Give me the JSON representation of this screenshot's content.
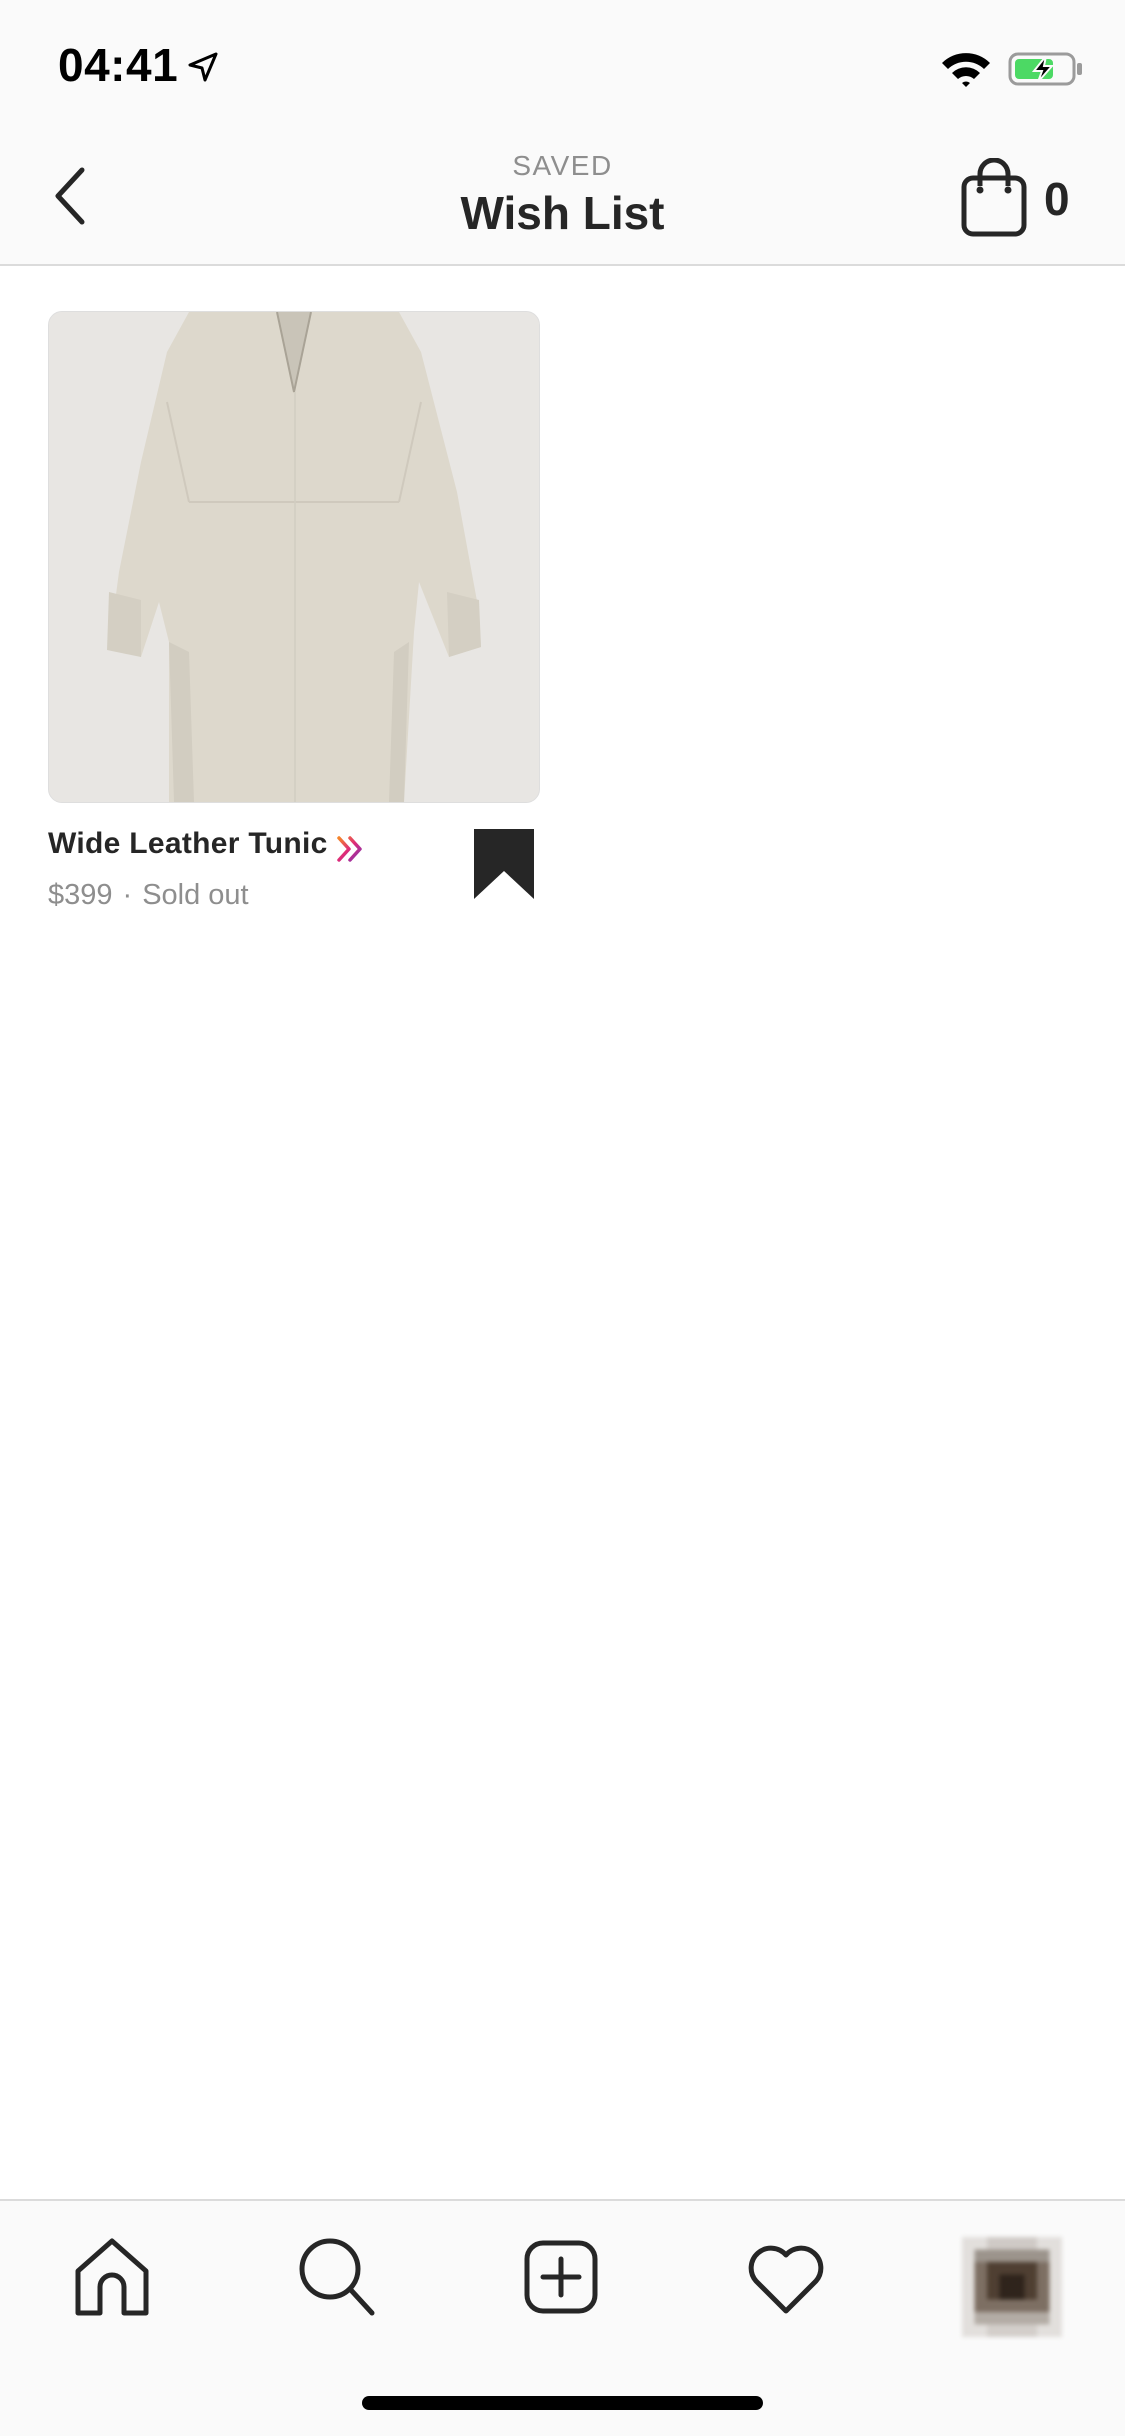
{
  "status_bar": {
    "time": "04:41",
    "icons": [
      "location-arrow-icon",
      "wifi-icon",
      "battery-charging-icon"
    ]
  },
  "header": {
    "kicker": "SAVED",
    "title": "Wish List",
    "back_icon": "chevron-left-icon",
    "bag_icon": "shopping-bag-icon",
    "bag_count": "0"
  },
  "products": [
    {
      "name": "Wide Leather Tunic",
      "price": "$399",
      "separator": "·",
      "availability": "Sold out",
      "image_icon": "tunic-photo",
      "badge_icon": "checkout-chevrons-icon",
      "bookmark_icon": "bookmark-filled-icon",
      "saved": true
    }
  ],
  "tab_bar": {
    "items": [
      "home-icon",
      "search-icon",
      "new-post-icon",
      "heart-icon",
      "profile-avatar"
    ]
  },
  "colors": {
    "text_primary": "#262626",
    "text_secondary": "#8e8e8e",
    "bar_background": "#fafafa",
    "divider": "#dbdbdb",
    "battery_green": "#4cd964",
    "checkout_gradient": [
      "#f58529",
      "#dd2a7b",
      "#8134af"
    ]
  }
}
